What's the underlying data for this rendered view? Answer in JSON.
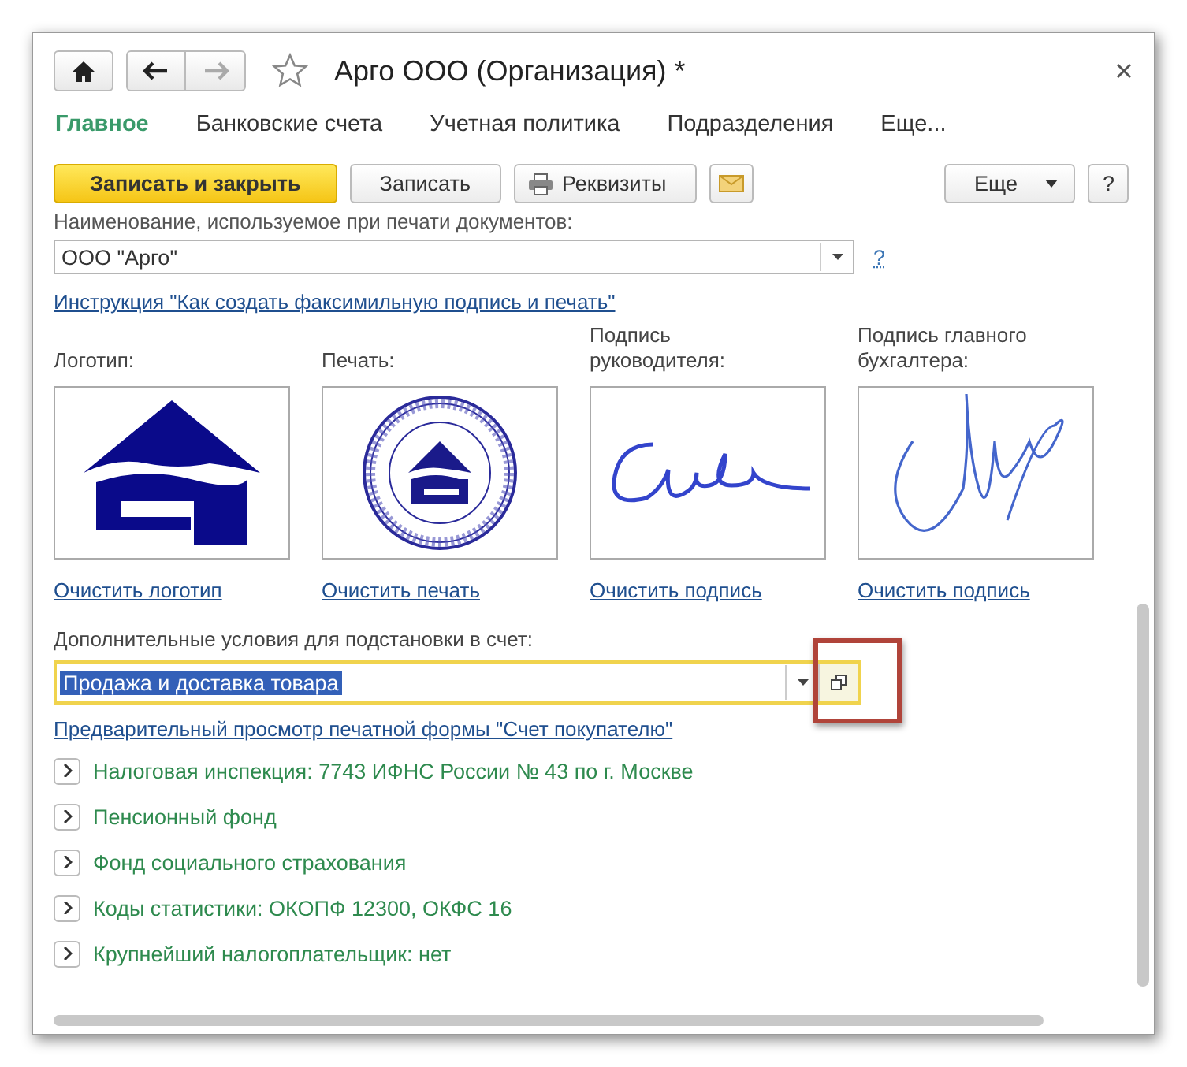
{
  "window": {
    "title": "Арго ООО (Организация) *",
    "favorite": false
  },
  "tabs": [
    {
      "label": "Главное",
      "selected": true
    },
    {
      "label": "Банковские счета",
      "selected": false
    },
    {
      "label": "Учетная политика",
      "selected": false
    },
    {
      "label": "Подразделения",
      "selected": false
    },
    {
      "label": "Еще...",
      "selected": false
    }
  ],
  "toolbar": {
    "buttons": [
      {
        "kind": "primary",
        "label": "Записать и закрыть"
      },
      {
        "kind": "default",
        "label": "Записать"
      },
      {
        "kind": "print",
        "label": "Реквизиты"
      },
      {
        "kind": "mail"
      }
    ],
    "more": "Еще",
    "help": "?"
  },
  "print_name": {
    "label": "Наименование, используемое при печати документов:",
    "value": "ООО \"Арго\"",
    "help": "?"
  },
  "instruction_link": "Инструкция \"Как создать факсимильную подпись и печать\"",
  "images": [
    {
      "kind": "logo",
      "label": "Логотип:",
      "clear": "Очистить логотип"
    },
    {
      "kind": "stamp",
      "label": "Печать:",
      "clear": "Очистить печать"
    },
    {
      "kind": "signature_head",
      "label": "Подпись руководителя:",
      "clear": "Очистить подпись"
    },
    {
      "kind": "signature_accountant",
      "label": "Подпись главного бухгалтера:",
      "clear": "Очистить подпись"
    }
  ],
  "conditions": {
    "label": "Дополнительные условия для подстановки в счет:",
    "value": "Продажа и доставка товара",
    "value_selected": true,
    "focused": true,
    "open_button_highlighted": true
  },
  "preview_link": "Предварительный просмотр печатной формы \"Счет покупателю\"",
  "groups": [
    {
      "label": "Налоговая инспекция: 7743 ИФНС России № 43 по г. Москве",
      "expanded": false
    },
    {
      "label": "Пенсионный фонд",
      "expanded": false
    },
    {
      "label": "Фонд социального страхования",
      "expanded": false
    },
    {
      "label": "Коды статистики: ОКОПФ 12300, ОКФС 16",
      "expanded": false
    },
    {
      "label": "Крупнейший налогоплательщик: нет",
      "expanded": false
    }
  ]
}
